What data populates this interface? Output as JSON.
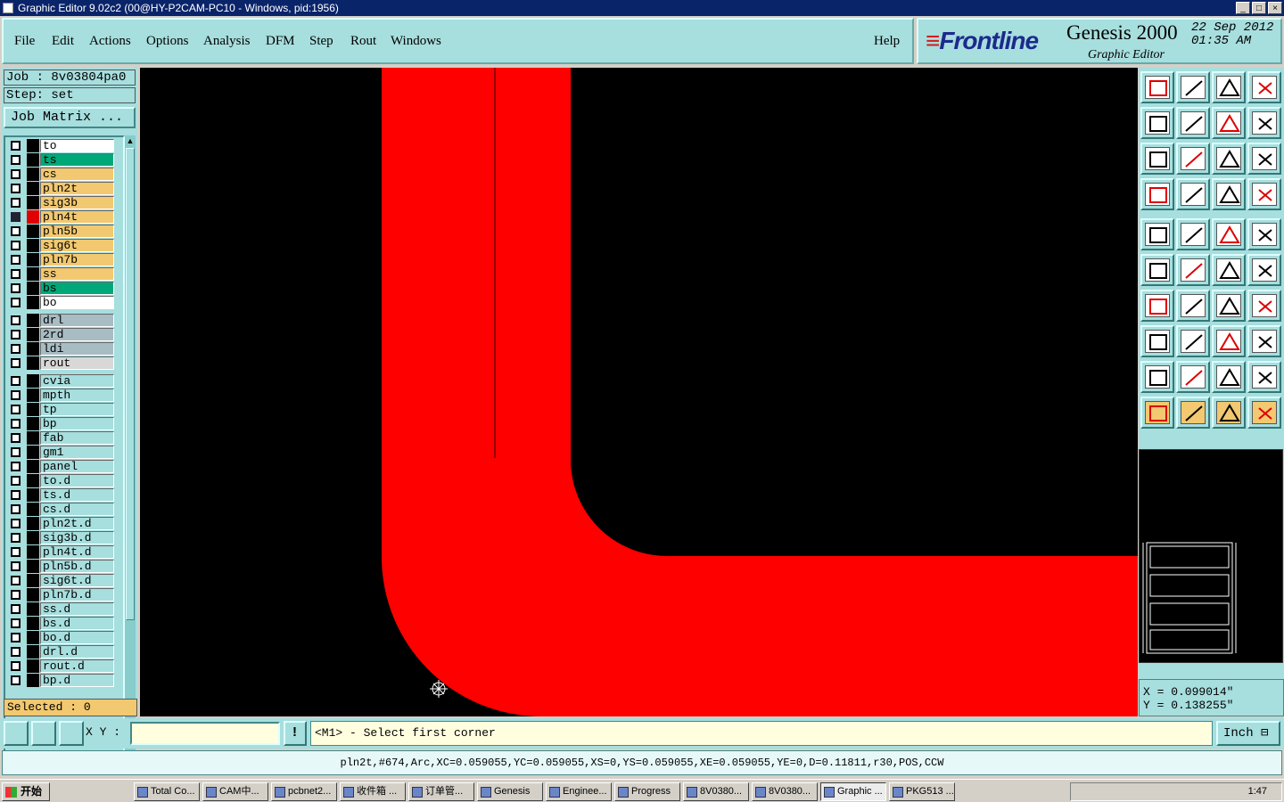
{
  "window": {
    "title": "Graphic Editor 9.02c2 (00@HY-P2CAM-PC10 - Windows, pid:1956)"
  },
  "menu": [
    "File",
    "Edit",
    "Actions",
    "Options",
    "Analysis",
    "DFM",
    "Step",
    "Rout",
    "Windows"
  ],
  "help_label": "Help",
  "logo": {
    "brand": "Frontline",
    "product": "Genesis 2000",
    "subtitle": "Graphic Editor",
    "date_line1": "22 Sep 2012",
    "date_line2": "01:35 AM"
  },
  "job": {
    "label": "Job : 8v03804pa0",
    "step": "Step: set",
    "matrix_button": "Job Matrix ..."
  },
  "layers": [
    {
      "name": "to",
      "color": "#ffffff"
    },
    {
      "name": "ts",
      "color": "#00a878"
    },
    {
      "name": "cs",
      "color": "#f2c870"
    },
    {
      "name": "pln2t",
      "color": "#f2c870"
    },
    {
      "name": "sig3b",
      "color": "#f2c870"
    },
    {
      "name": "pln4t",
      "color": "#f2c870",
      "active": true
    },
    {
      "name": "pln5b",
      "color": "#f2c870"
    },
    {
      "name": "sig6t",
      "color": "#f2c870"
    },
    {
      "name": "pln7b",
      "color": "#f2c870"
    },
    {
      "name": "ss",
      "color": "#f2c870"
    },
    {
      "name": "bs",
      "color": "#00a878"
    },
    {
      "name": "bo",
      "color": "#ffffff"
    },
    {
      "name": "drl",
      "color": "#a8bcc4",
      "group_gap": true
    },
    {
      "name": "2rd",
      "color": "#a8bcc4"
    },
    {
      "name": "ldi",
      "color": "#a8bcc4"
    },
    {
      "name": "rout",
      "color": "#d8d8d8"
    },
    {
      "name": "cvia",
      "color": "#a7dede",
      "group_gap": true
    },
    {
      "name": "mpth",
      "color": "#a7dede"
    },
    {
      "name": "tp",
      "color": "#a7dede"
    },
    {
      "name": "bp",
      "color": "#a7dede"
    },
    {
      "name": "fab",
      "color": "#a7dede"
    },
    {
      "name": "gm1",
      "color": "#a7dede"
    },
    {
      "name": "panel",
      "color": "#a7dede"
    },
    {
      "name": "to.d",
      "color": "#a7dede"
    },
    {
      "name": "ts.d",
      "color": "#a7dede"
    },
    {
      "name": "cs.d",
      "color": "#a7dede"
    },
    {
      "name": "pln2t.d",
      "color": "#a7dede"
    },
    {
      "name": "sig3b.d",
      "color": "#a7dede"
    },
    {
      "name": "pln4t.d",
      "color": "#a7dede"
    },
    {
      "name": "pln5b.d",
      "color": "#a7dede"
    },
    {
      "name": "sig6t.d",
      "color": "#a7dede"
    },
    {
      "name": "pln7b.d",
      "color": "#a7dede"
    },
    {
      "name": "ss.d",
      "color": "#a7dede"
    },
    {
      "name": "bs.d",
      "color": "#a7dede"
    },
    {
      "name": "bo.d",
      "color": "#a7dede"
    },
    {
      "name": "drl.d",
      "color": "#a7dede"
    },
    {
      "name": "rout.d",
      "color": "#a7dede"
    },
    {
      "name": "bp.d",
      "color": "#a7dede"
    }
  ],
  "selected": "Selected : 0",
  "coords": {
    "x": "X = 0.099014\"",
    "y": "Y = 0.138255\""
  },
  "xy_label": "X Y :",
  "prompt": "<M1> - Select first corner",
  "units": "Inch",
  "status": "pln2t,#674,Arc,XC=0.059055,YC=0.059055,XS=0,YS=0.059055,XE=0.059055,YE=0,D=0.11811,r30,POS,CCW",
  "tools": [
    "display-layer-icon",
    "zoom-home-icon",
    "home-icon",
    "window-icon",
    "pan-left-icon",
    "pan-right-icon",
    "undo-icon",
    "redraw-icon",
    "zoom-fit-icon",
    "zoom-center-icon",
    "zoom-1to2-icon",
    "help-icon",
    "settings-icon",
    "snap-icon",
    "layers-a-icon",
    "layers-b-icon",
    "fill-mode-icon",
    "outline-icon",
    "ruler-icon",
    "pad-icon",
    "add-pad-icon",
    "cross-icon",
    "line-point-icon",
    "line-point2-icon",
    "angle-icon",
    "line-icon",
    "arc-icon",
    "text-f-icon",
    "feature-icon",
    "minus-icon",
    "measure-icon",
    "shapes-icon",
    "poly-a-icon",
    "poly-b-icon",
    "poly-c-icon",
    "poly-d-icon",
    "pointer-icon",
    "pointer-box-icon",
    "pointer-circle-icon",
    "pointer-route-icon"
  ],
  "taskbar": {
    "start": "开始",
    "tasks": [
      "Total Co...",
      "CAM中...",
      "pcbnet2...",
      "收件箱 ...",
      "订单管...",
      "Genesis",
      "Enginee...",
      "Progress",
      "8V0380...",
      "8V0380...",
      "Graphic ...",
      "PKG513 ..."
    ],
    "active_task": 10,
    "clock": "1:47"
  },
  "colors": {
    "panel": "#a7dede",
    "feature": "#ff0000",
    "canvas": "#000000"
  }
}
